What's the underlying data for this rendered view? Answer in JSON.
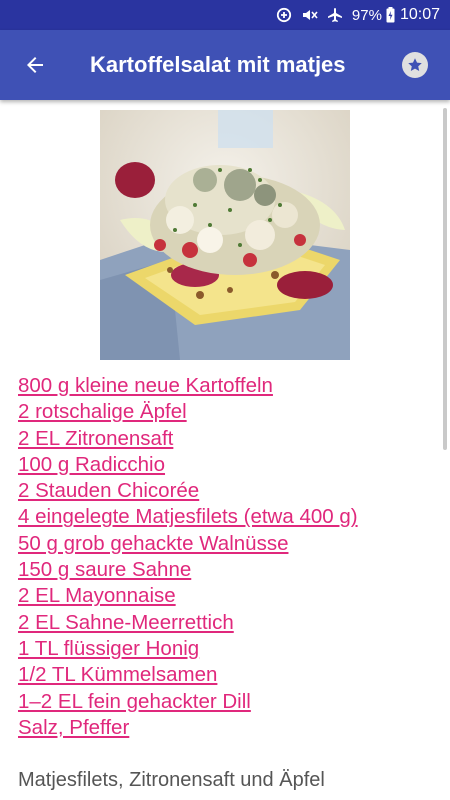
{
  "status_bar": {
    "battery": "97%",
    "time": "10:07",
    "icons": [
      "data-saver-icon",
      "mute-icon",
      "airplane-mode-icon",
      "battery-charging-icon"
    ]
  },
  "app_bar": {
    "title": "Kartoffelsalat mit matjes",
    "back_icon": "arrow-back-icon",
    "favorite_icon": "star-icon"
  },
  "recipe": {
    "image_alt": "recipe-photo",
    "ingredients": [
      "800 g kleine neue Kartoffeln",
      "2 rotschalige Äpfel",
      "2 EL Zitronensaft",
      "100 g Radicchio",
      "2 Stauden Chicorée",
      "4 eingelegte Matjesfilets (etwa 400 g)",
      "50 g grob gehackte Walnüsse",
      "150 g saure Sahne",
      "2 EL Mayonnaise",
      "2 EL Sahne-Meerrettich",
      "1 TL flüssiger Honig",
      "1/2 TL Kümmelsamen",
      "1–2 EL fein gehackter Dill",
      "Salz, Pfeffer"
    ],
    "instructions": "Matjesfilets, Zitronensaft und Äpfel"
  },
  "colors": {
    "status_bar": "#2a34a0",
    "app_bar": "#3f51b5",
    "ingredient_link": "#e0287c",
    "body_text": "#555555"
  }
}
